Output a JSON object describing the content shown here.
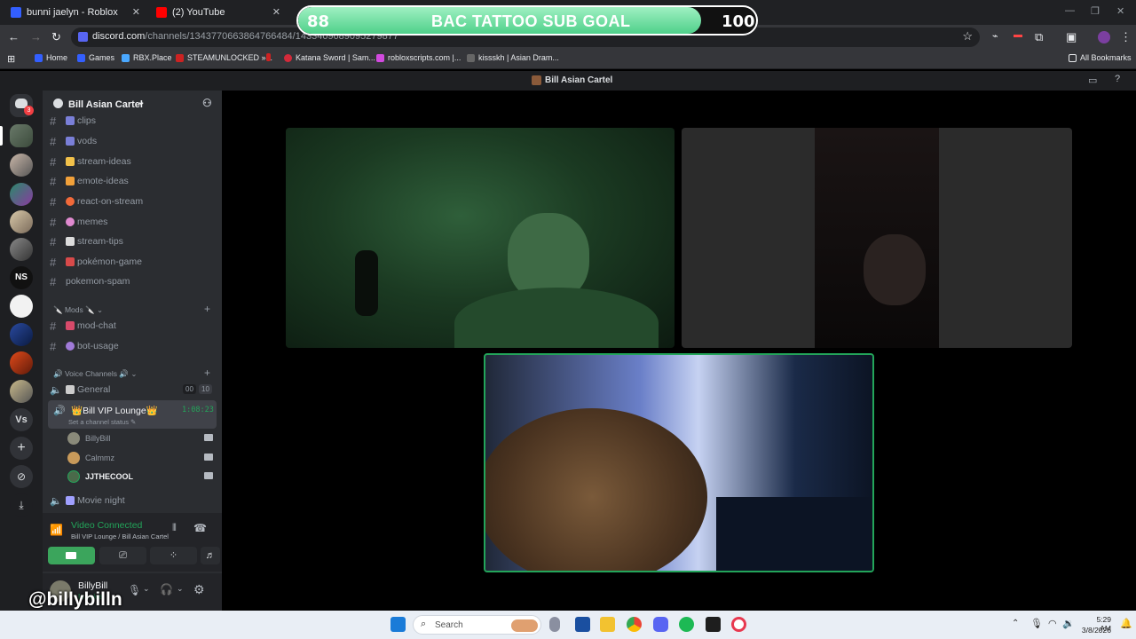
{
  "browser": {
    "tabs": [
      {
        "title": "bunni jaelyn - Roblox",
        "close": "✕"
      },
      {
        "title": "(2) YouTube",
        "close": "✕"
      }
    ],
    "url_host": "discord.com",
    "url_path": "/channels/1343770663864766484/1433409689095279877",
    "bookmarks": [
      "Home",
      "Games",
      "RBX.Place",
      "STEAMUNLOCKED »...",
      "Katana Sword | Sam...",
      "robloxscripts.com |...",
      "kissskh | Asian Dram..."
    ],
    "all_bookmarks": "All Bookmarks"
  },
  "overlay": {
    "title": "BAC TATTOO SUB GOAL",
    "current": "88",
    "goal": "100",
    "progress_fraction": 0.88,
    "watermark": "@billybilln"
  },
  "discord": {
    "window_title": "Bill Asian Cartel",
    "notif_count": "3",
    "server_name": "Bill Asian Cartel",
    "channels": [
      "clips",
      "vods",
      "stream-ideas",
      "emote-ideas",
      "react-on-stream",
      "memes",
      "stream-tips",
      "pokémon-game",
      "pokemon-spam"
    ],
    "mods_category": "Mods",
    "mod_channels": [
      "mod-chat",
      "bot-usage"
    ],
    "voice_category": "Voice Channels",
    "general": {
      "name": "General",
      "count_a": "00",
      "count_b": "10"
    },
    "vip_lounge": {
      "name": "Bill VIP Lounge",
      "timer": "1:08:23",
      "status": "Set a channel status"
    },
    "voice_users": [
      "BillyBill",
      "Calmmz",
      "JJTHECOOL"
    ],
    "movie_night": "Movie night",
    "panel": {
      "status": "Video Connected",
      "location": "Bill VIP Lounge / Bill Asian Cartel"
    },
    "user": {
      "name": "BillyBill",
      "status": "In voice"
    },
    "guild_label": "Vs"
  },
  "taskbar": {
    "search": "Search",
    "time": "5:29 AM",
    "date": "3/8/2026"
  },
  "colors": {
    "discord_green": "#23a55a",
    "goal_fill": "#4fd08a",
    "sidebar": "#2b2d31"
  }
}
